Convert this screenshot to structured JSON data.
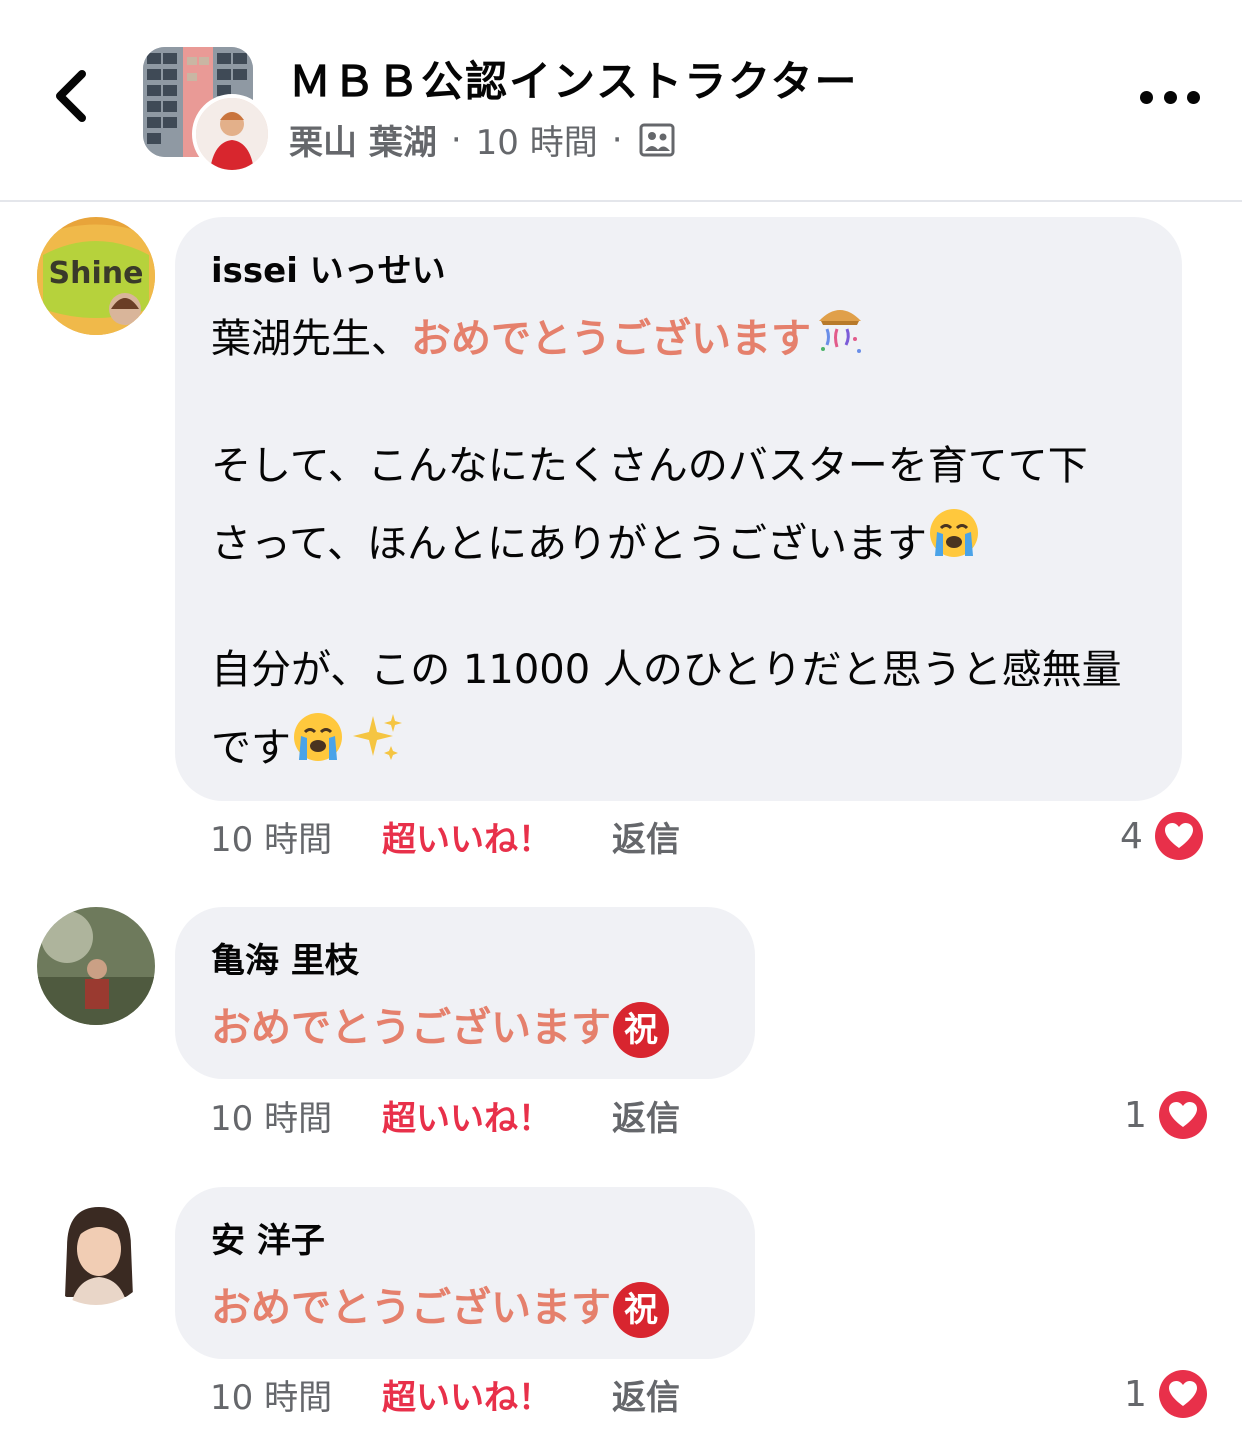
{
  "header": {
    "group_name": "ＭＢＢ公認インストラクター",
    "author": "栗山 葉湖",
    "time": "10 時間",
    "separator": "·"
  },
  "comments": [
    {
      "name": "issei いっせい",
      "line1_plain": "葉湖先生、",
      "line1_highlight": "おめでとうございます",
      "line2": "そして、こんなにたくさんのバスターを育てて下",
      "line3": "さって、ほんとにありがとうございます",
      "line4": "自分が、この 11000 人のひとりだと思うと感無量",
      "line5": "です",
      "time": "10 時間",
      "react_label": "超いいね！",
      "reply_label": "返信",
      "reaction_count": "4",
      "avatar_text": "Shine"
    },
    {
      "name": "亀海 里枝",
      "highlight": "おめでとうございます",
      "badge": "祝",
      "time": "10 時間",
      "react_label": "超いいね！",
      "reply_label": "返信",
      "reaction_count": "1"
    },
    {
      "name": "安 洋子",
      "highlight": "おめでとうございます",
      "badge": "祝",
      "time": "10 時間",
      "react_label": "超いいね！",
      "reply_label": "返信",
      "reaction_count": "1"
    }
  ],
  "colors": {
    "highlight": "#e5806c",
    "reaction": "#e8304a",
    "bubble": "#f0f1f5",
    "meta": "#65676b"
  }
}
